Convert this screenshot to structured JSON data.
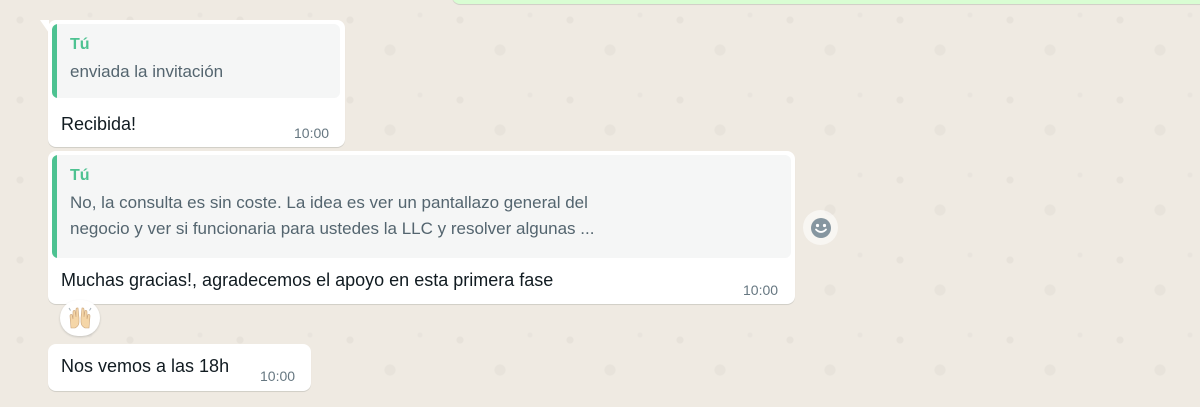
{
  "messages": [
    {
      "quote": {
        "author": "Tú",
        "text": "enviada la invitación"
      },
      "text": "Recibida!",
      "time": "10:00"
    },
    {
      "quote": {
        "author": "Tú",
        "line1": "No, la consulta es sin coste. La idea es ver un pantallazo general del",
        "line2": "negocio y ver si funcionaria para ustedes la LLC y resolver algunas ..."
      },
      "text": "Muchas gracias!, agradecemos el apoyo en esta primera fase",
      "time": "10:00",
      "reaction": "raising-hands-emoji"
    },
    {
      "text": "Nos vemos a las 18h",
      "time": "10:00"
    }
  ],
  "icons": {
    "react_button": "smiley-icon"
  },
  "colors": {
    "chat_background": "#efeae2",
    "incoming_bubble": "#ffffff",
    "outgoing_bubble": "#d9fdd3",
    "quote_accent": "#4dc291",
    "quote_background": "#f5f6f6",
    "timestamp": "#667781"
  }
}
